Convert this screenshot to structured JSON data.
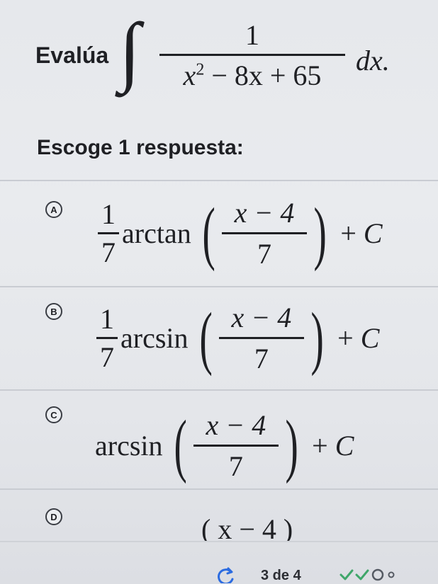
{
  "question": {
    "verb": "Evalúa",
    "numerator": "1",
    "denominator_base": "x",
    "denominator_exp": "2",
    "denominator_rest": " − 8x + 65",
    "differential": "dx."
  },
  "prompt": "Escoge 1 respuesta:",
  "choices": [
    {
      "letter": "A",
      "coef_num": "1",
      "coef_den": "7",
      "fn": "arctan",
      "arg_num": "x − 4",
      "arg_den": "7",
      "tail": "+ ",
      "const": "C"
    },
    {
      "letter": "B",
      "coef_num": "1",
      "coef_den": "7",
      "fn": "arcsin",
      "arg_num": "x − 4",
      "arg_den": "7",
      "tail": "+ ",
      "const": "C"
    },
    {
      "letter": "C",
      "fn": "arcsin",
      "arg_num": "x − 4",
      "arg_den": "7",
      "tail": "+ ",
      "const": "C"
    },
    {
      "letter": "D",
      "partial": "( x − 4 )"
    }
  ],
  "footer": {
    "progress": "3 de 4",
    "icons": [
      "refresh-icon",
      "check-icon",
      "check-icon",
      "circle-icon",
      "dot-icon"
    ]
  },
  "colors": {
    "text": "#1f2024",
    "check": "#3fa66a",
    "refresh": "#2b6be0"
  }
}
